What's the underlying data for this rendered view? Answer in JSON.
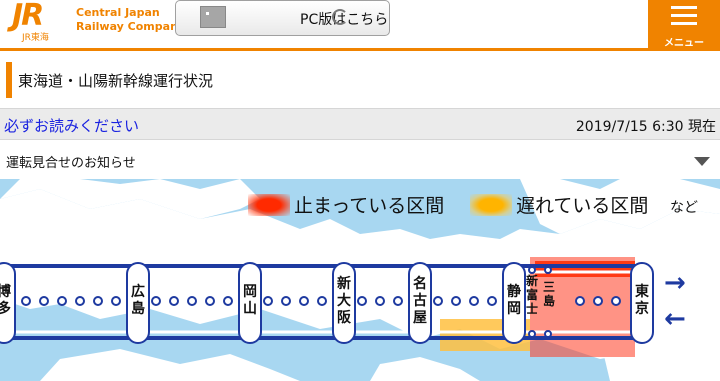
{
  "header": {
    "logo_text": "JR",
    "logo_sub": "JR東海",
    "company_line1": "Central Japan",
    "company_line2": "Railway Company",
    "pc_link": "PC版はこちら",
    "menu_label": "メニュー"
  },
  "page_title": "東海道・山陽新幹線運行状況",
  "notice": {
    "link": "必ずお読みください",
    "date": "2019/7/15 6:30 現在"
  },
  "section": {
    "title": "運転見合せのお知らせ"
  },
  "legend": {
    "stopped": "止まっている区間",
    "delayed": "遅れている区間",
    "etc": "など",
    "stopped_color": "#ff2a00",
    "delayed_color": "#ffb400"
  },
  "stations": [
    {
      "id": "hakata",
      "label": "博多"
    },
    {
      "id": "hiroshima",
      "label": "広島"
    },
    {
      "id": "okayama",
      "label": "岡山"
    },
    {
      "id": "shin-osaka",
      "label": "新大阪"
    },
    {
      "id": "nagoya",
      "label": "名古屋"
    },
    {
      "id": "shizuoka",
      "label": "静岡"
    },
    {
      "id": "shin-fuji",
      "label": "新富士"
    },
    {
      "id": "mishima",
      "label": "三島"
    },
    {
      "id": "tokyo",
      "label": "東京"
    }
  ],
  "directions": {
    "outbound": "→",
    "inbound": "←"
  },
  "colors": {
    "brand": "#f08300",
    "line": "#1e3aa0",
    "sea": "#a8d7f1",
    "link": "#1a22e0"
  }
}
